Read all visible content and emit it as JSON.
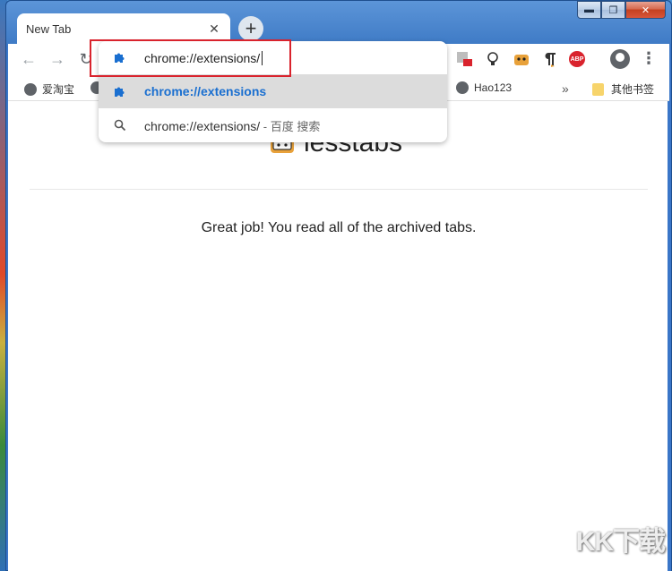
{
  "window": {
    "controls": {
      "minimize": "▬",
      "maximize": "❐",
      "close": "✕"
    }
  },
  "tab": {
    "title": "New Tab",
    "close": "✕"
  },
  "new_tab": "+",
  "toolbar": {
    "back": "←",
    "forward": "→",
    "reload": "↻",
    "menu": "⋮",
    "abp_label": "ABP"
  },
  "omnibox": {
    "input_value": "chrome://extensions/",
    "suggestions": [
      {
        "text": "chrome://extensions",
        "icon": "puzzle-icon",
        "selected": true
      },
      {
        "text": "chrome://extensions/",
        "suffix": " - 百度 搜索",
        "icon": "search-icon",
        "selected": false
      }
    ]
  },
  "bookmarks": {
    "items": [
      {
        "label": "爱淘宝",
        "icon": "globe-icon"
      },
      {
        "label": "Hao123",
        "icon": "globe-icon"
      }
    ],
    "overflow": "»",
    "other": "其他书签"
  },
  "page": {
    "logo_text": "lesstabs",
    "message": "Great job! You read all of the archived tabs."
  },
  "watermark": "KK下载",
  "colors": {
    "accent_blue": "#1a6fd0",
    "highlight_red": "#d9232d",
    "frame_blue": "#3a76c8"
  }
}
